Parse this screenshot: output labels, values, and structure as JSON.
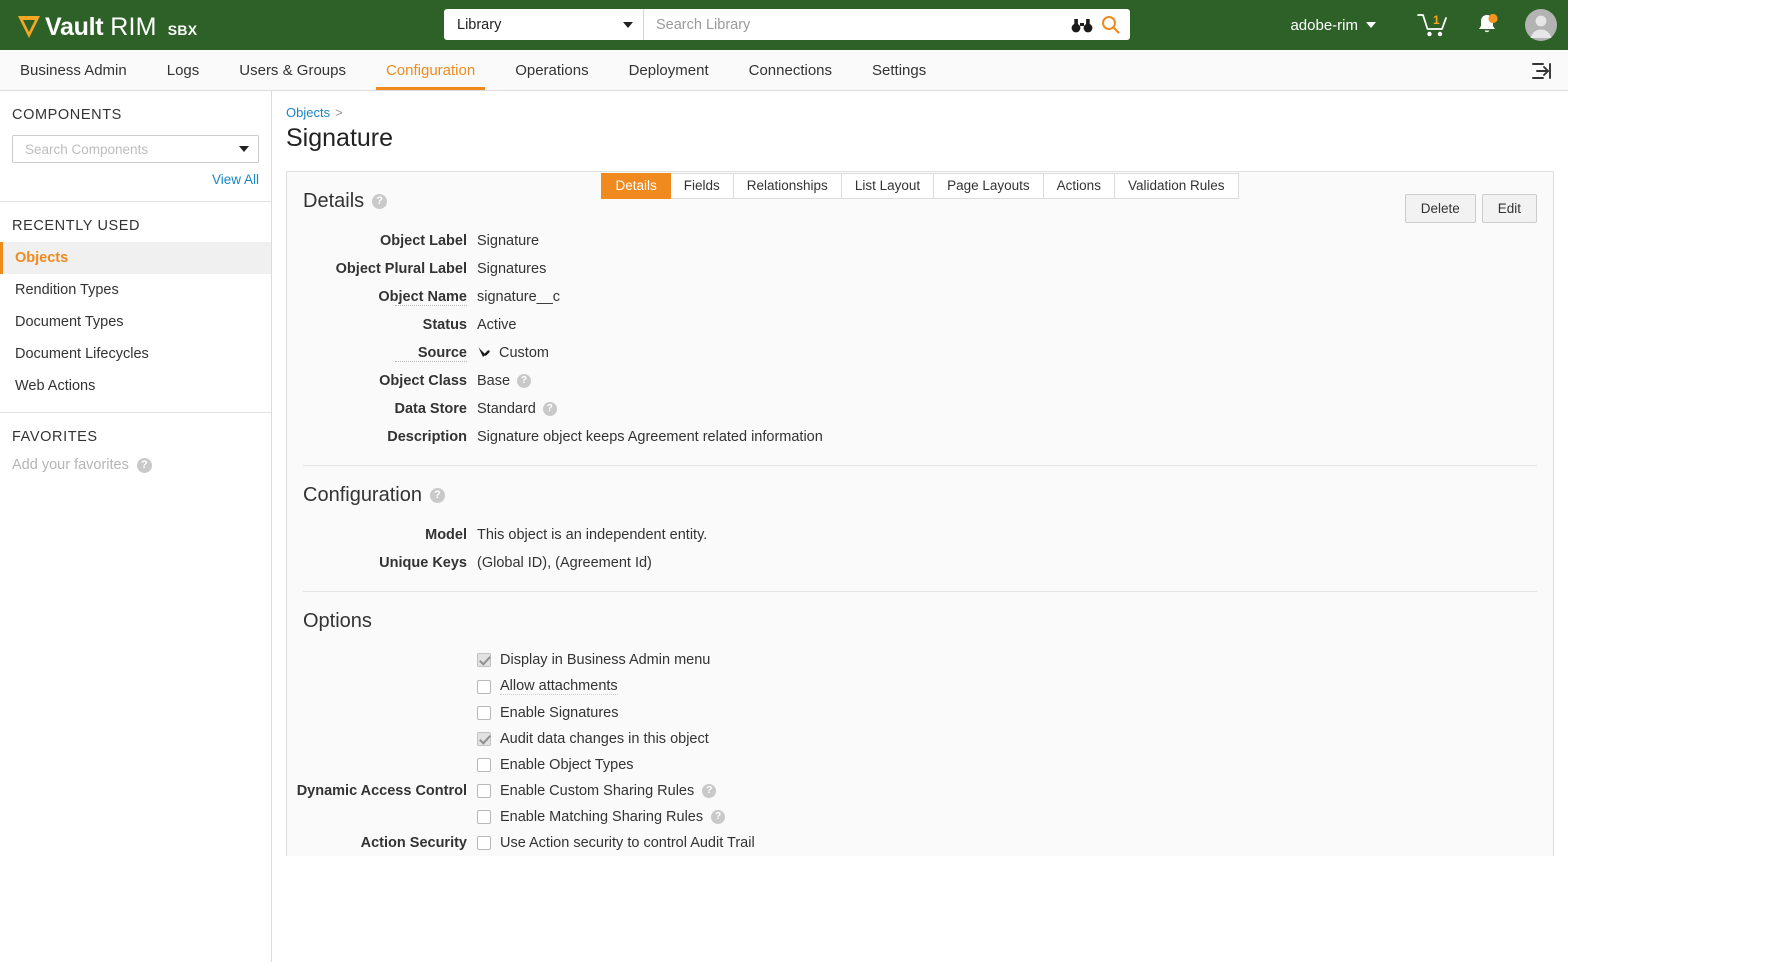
{
  "topbar": {
    "logo_vault": "Vault",
    "logo_rim": "RIM",
    "logo_env": "SBX",
    "scope_selected": "Library",
    "search_placeholder": "Search Library",
    "search_value": "",
    "username": "adobe-rim",
    "cart_count": "1",
    "icons": [
      "binoculars-icon",
      "search-icon",
      "cart-icon",
      "bell-icon",
      "avatar-icon"
    ]
  },
  "nav": {
    "items": [
      {
        "label": "Business Admin",
        "active": false
      },
      {
        "label": "Logs",
        "active": false
      },
      {
        "label": "Users & Groups",
        "active": false
      },
      {
        "label": "Configuration",
        "active": true
      },
      {
        "label": "Operations",
        "active": false
      },
      {
        "label": "Deployment",
        "active": false
      },
      {
        "label": "Connections",
        "active": false
      },
      {
        "label": "Settings",
        "active": false
      }
    ],
    "accent": "#f08a1e"
  },
  "sidebar": {
    "components_title": "COMPONENTS",
    "components_search_placeholder": "Search Components",
    "components_search_value": "",
    "view_all": "View All",
    "recently_used_title": "RECENTLY USED",
    "recent_items": [
      {
        "label": "Objects",
        "active": true
      },
      {
        "label": "Rendition Types",
        "active": false
      },
      {
        "label": "Document Types",
        "active": false
      },
      {
        "label": "Document Lifecycles",
        "active": false
      },
      {
        "label": "Web Actions",
        "active": false
      }
    ],
    "favorites_title": "FAVORITES",
    "favorites_empty": "Add your favorites"
  },
  "breadcrumb": {
    "parent": "Objects",
    "separator": ">"
  },
  "page": {
    "title": "Signature"
  },
  "tabs": [
    {
      "label": "Details",
      "active": true
    },
    {
      "label": "Fields",
      "active": false
    },
    {
      "label": "Relationships",
      "active": false
    },
    {
      "label": "List Layout",
      "active": false
    },
    {
      "label": "Page Layouts",
      "active": false
    },
    {
      "label": "Actions",
      "active": false
    },
    {
      "label": "Validation Rules",
      "active": false
    }
  ],
  "details": {
    "heading": "Details",
    "delete_label": "Delete",
    "edit_label": "Edit",
    "rows": [
      {
        "label": "Object Label",
        "value": "Signature",
        "help": false,
        "icon": null
      },
      {
        "label": "Object Plural Label",
        "value": "Signatures",
        "help": false,
        "icon": null
      },
      {
        "label": "Object Name",
        "value": "signature__c",
        "help": false,
        "icon": null
      },
      {
        "label": "Status",
        "value": "Active",
        "help": false,
        "icon": null
      },
      {
        "label": "Source",
        "value": "Custom",
        "help": false,
        "icon": "hammer-icon"
      },
      {
        "label": "Object Class",
        "value": "Base",
        "help": true,
        "icon": null
      },
      {
        "label": "Data Store",
        "value": "Standard",
        "help": true,
        "icon": null
      },
      {
        "label": "Description",
        "value": "Signature object keeps Agreement related information",
        "help": false,
        "icon": null
      }
    ]
  },
  "configuration": {
    "heading": "Configuration",
    "rows": [
      {
        "label": "Model",
        "value": "This object is an independent entity."
      },
      {
        "label": "Unique Keys",
        "value": "(Global ID), (Agreement Id)"
      }
    ]
  },
  "options": {
    "heading": "Options",
    "items": [
      {
        "group": "",
        "label": "Display in Business Admin menu",
        "checked": true,
        "help": false
      },
      {
        "group": "",
        "label": "Allow attachments",
        "checked": false,
        "help": false
      },
      {
        "group": "",
        "label": "Enable Signatures",
        "checked": false,
        "help": false
      },
      {
        "group": "",
        "label": "Audit data changes in this object",
        "checked": true,
        "help": false
      },
      {
        "group": "",
        "label": "Enable Object Types",
        "checked": false,
        "help": false
      },
      {
        "group": "Dynamic Access Control",
        "label": "Enable Custom Sharing Rules",
        "checked": false,
        "help": true
      },
      {
        "group": "",
        "label": "Enable Matching Sharing Rules",
        "checked": false,
        "help": true
      },
      {
        "group": "Action Security",
        "label": "Use Action security to control Audit Trail",
        "checked": false,
        "help": false
      }
    ]
  }
}
